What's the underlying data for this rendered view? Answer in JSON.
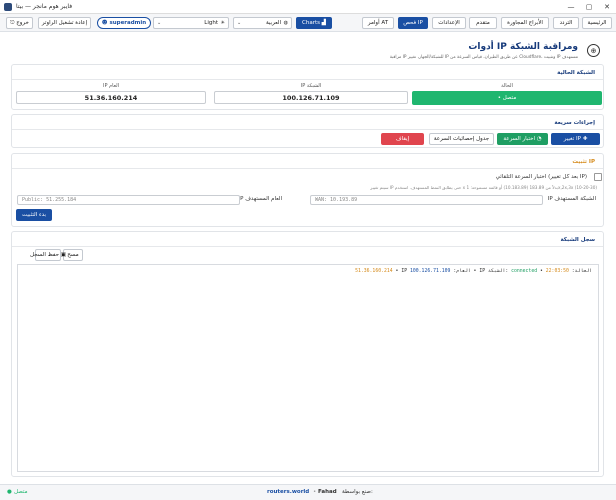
{
  "window": {
    "title": "فايبر هوم مانجر — بيتا",
    "controls": {
      "minimize": "—",
      "maximize": "▢",
      "close": "✕"
    }
  },
  "navbar": {
    "exit_label": "خروج",
    "restart_label": "إعادة تشغيل الراوتر",
    "user_label": "superadmin",
    "theme_select": "Light",
    "language_select": "العربية",
    "charts_label": "Charts",
    "tabs": [
      {
        "label": "أوامر AT"
      },
      {
        "label": "فحص IP"
      },
      {
        "label": "الإعدادات"
      },
      {
        "label": "متقدم"
      },
      {
        "label": "الأبراج المجاورة"
      },
      {
        "label": "التردد"
      },
      {
        "label": "الرئيسية"
      }
    ],
    "active_tab": "فحص IP"
  },
  "page": {
    "title": "أدوات IP ومراقبة الشبكة",
    "subtitle": "مراقبة IP للشبكة/الجهاز، تغيير IP عن طريق الطيران، قياس السرعة من Cloudflare، وتثبيت IP مستهدف"
  },
  "current_network": {
    "title": "الشبكة الحالية",
    "state_label": "الحالة",
    "state_value": "• متصل",
    "network_label": "IP الشبكة",
    "network_ip": "100.126.71.109",
    "public_label": "IP العام",
    "public_ip": "51.36.160.214"
  },
  "quick_actions": {
    "title": "إجراءات سريعة",
    "change_ip": "تغيير IP",
    "speed_test": "اختبار السرعة",
    "speed_table": "جدول إحصائيات السرعة",
    "stop": "إيقاف"
  },
  "pin_ip": {
    "title": "تثبيت IP",
    "auto_speed_test": "اختبار السرعة التلقائي (بعد كل تغيير IP)",
    "hint": "سيتم تغيير IP حتى يطابق النمط المستهدف. استخدم x بدلاً من 183.89 (10.183.89) أو قائمة مسموحة: 1x,2x,3x (10-20-30)",
    "network_target_label": "IP الشبكة المستهدف",
    "network_target_placeholder": "WAN: 10.193.89",
    "public_target_label": "IP العام المستهدف",
    "public_target_placeholder": "Public: 51.255.184",
    "start_button": "بدء التثبيت"
  },
  "network_log": {
    "title": "سجل الشبكة",
    "clear_button": "مسح",
    "save_button": "حفظ السجل",
    "entries": [
      {
        "time": "22:03:50",
        "state_prefix": "• الحالة:",
        "state": "connected",
        "network_prefix": "• IP الشبكة:",
        "network_ip": "100.126.71.109",
        "public_prefix": "• IP العام:",
        "public_ip": "51.36.160.214"
      }
    ]
  },
  "footer": {
    "status": "متصل",
    "credit_prefix": "صنع بواسطة:",
    "author": "Fahad",
    "site": "routers.world"
  },
  "colors": {
    "primary": "#1a4fa3",
    "success": "#1fb66f",
    "danger": "#e0454e",
    "accent_orange": "#d58a1a"
  }
}
